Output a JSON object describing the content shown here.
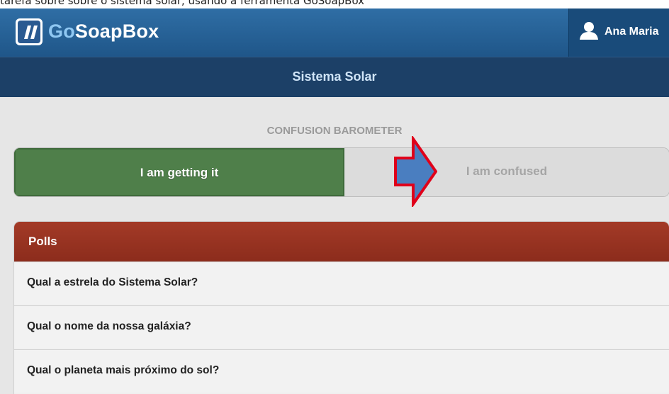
{
  "top_caption": "tarefa sobre sobre o sistema solar, usando a ferramenta GoSoapBox",
  "app": {
    "logo_prefix": "Go",
    "logo_suffix": "SoapBox",
    "user_name": "Ana Maria"
  },
  "event": {
    "title": "Sistema Solar"
  },
  "barometer": {
    "label": "CONFUSION BAROMETER",
    "getting_it": "I am getting it",
    "confused": "I am confused"
  },
  "polls": {
    "header": "Polls",
    "items": [
      {
        "question": "Qual a estrela do Sistema Solar?"
      },
      {
        "question": "Qual o nome da nossa galáxia?"
      },
      {
        "question": "Qual o planeta mais próximo do sol?"
      }
    ]
  },
  "colors": {
    "appbar": "#2f6ea5",
    "subbar": "#1c4067",
    "getting_it": "#4f7f4a",
    "polls_header": "#9a3323",
    "annotation_arrow_fill": "#4a7ec0",
    "annotation_arrow_stroke": "#e0001a"
  },
  "icons": {
    "logo": "gosoapbox-logo-icon",
    "user": "user-icon",
    "annotation": "arrow-right-icon"
  }
}
